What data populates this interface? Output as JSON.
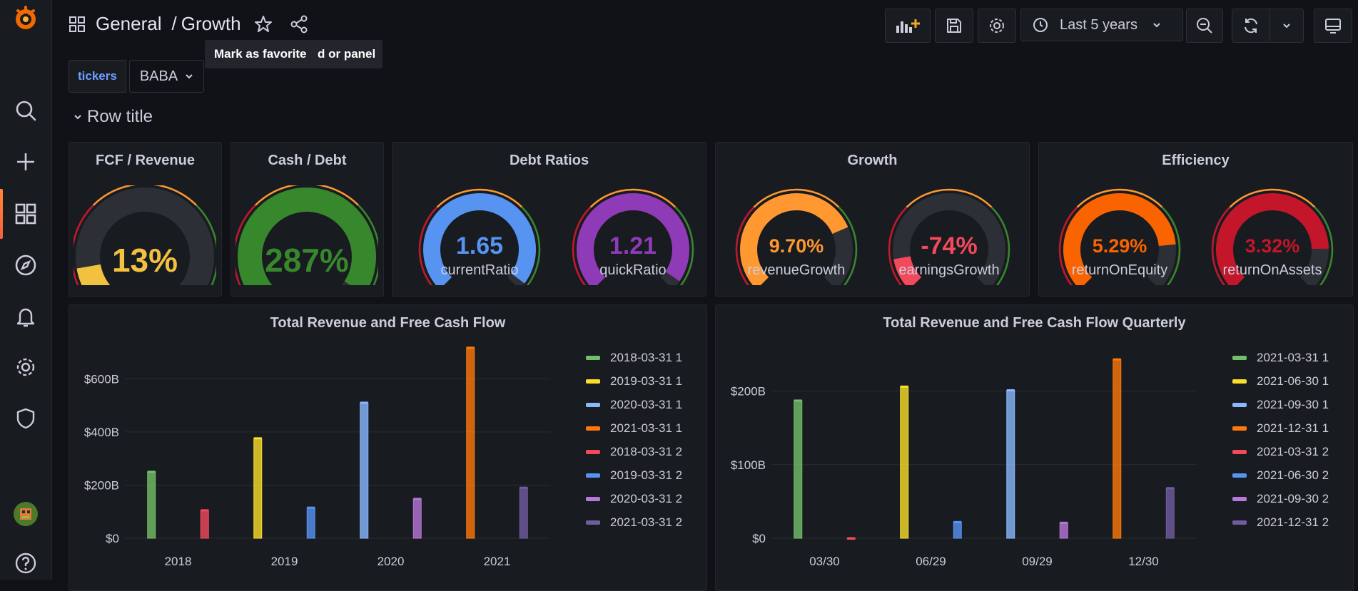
{
  "header": {
    "folder": "General",
    "separator": "/",
    "dashboard": "Growth",
    "time_range": "Last 5 years",
    "tooltip_left": "Mark as favorite",
    "tooltip_right": "d or panel"
  },
  "variables": {
    "label": "tickers",
    "value": "BABA"
  },
  "row": {
    "title": "Row title"
  },
  "panels": {
    "fcf": {
      "title": "FCF / Revenue"
    },
    "cash": {
      "title": "Cash / Debt"
    },
    "debt": {
      "title": "Debt Ratios"
    },
    "growth": {
      "title": "Growth"
    },
    "efficiency": {
      "title": "Efficiency"
    }
  },
  "gauges": [
    {
      "key": "fcf",
      "value_text": "13%",
      "value": 13,
      "min": 0,
      "max": 100,
      "label": "",
      "color": "#f2c140"
    },
    {
      "key": "cash",
      "value_text": "287%",
      "value": 287,
      "min": 0,
      "max": 300,
      "label": "",
      "color": "#37872d"
    },
    {
      "key": "current",
      "value_text": "1.65",
      "value": 1.65,
      "min": 0,
      "max": 1.7,
      "label": "currentRatio",
      "color": "#5794f2"
    },
    {
      "key": "quick",
      "value_text": "1.21",
      "value": 1.21,
      "min": 0,
      "max": 1.26,
      "label": "quickRatio",
      "color": "#8f3bb8"
    },
    {
      "key": "revenueGrowth",
      "value_text": "9.70%",
      "value": 9.7,
      "min": 0,
      "max": 13,
      "label": "revenueGrowth",
      "color": "#ff9830"
    },
    {
      "key": "earningsGrowth",
      "value_text": "-74%",
      "value": -74,
      "min": -100,
      "max": 100,
      "label": "earningsGrowth",
      "color": "#f2495c"
    },
    {
      "key": "roe",
      "value_text": "5.29%",
      "value": 5.29,
      "min": 0,
      "max": 6.5,
      "label": "returnOnEquity",
      "color": "#fa6400"
    },
    {
      "key": "roa",
      "value_text": "3.32%",
      "value": 3.32,
      "min": 0,
      "max": 4,
      "label": "returnOnAssets",
      "color": "#c4162a"
    }
  ],
  "chart_data": [
    {
      "type": "bar",
      "title": "Total Revenue and Free Cash Flow",
      "categories": [
        "2018",
        "2019",
        "2020",
        "2021"
      ],
      "y_ticks": [
        "$0",
        "$200B",
        "$400B",
        "$600B"
      ],
      "ylim": [
        0,
        770
      ],
      "series": [
        {
          "name": "2018-03-31 1",
          "color": "#73bf69",
          "values": [
            250,
            null,
            null,
            null
          ]
        },
        {
          "name": "2019-03-31 1",
          "color": "#fade2a",
          "values": [
            null,
            376,
            null,
            null
          ]
        },
        {
          "name": "2020-03-31 1",
          "color": "#8ab8ff",
          "values": [
            null,
            null,
            510,
            null
          ]
        },
        {
          "name": "2021-03-31 1",
          "color": "#ff780a",
          "values": [
            null,
            null,
            null,
            717
          ]
        },
        {
          "name": "2018-03-31 2",
          "color": "#f2495c",
          "values": [
            105,
            null,
            null,
            null
          ]
        },
        {
          "name": "2019-03-31 2",
          "color": "#5794f2",
          "values": [
            null,
            115,
            null,
            null
          ]
        },
        {
          "name": "2020-03-31 2",
          "color": "#b877d9",
          "values": [
            null,
            null,
            148,
            null
          ]
        },
        {
          "name": "2021-03-31 2",
          "color": "#705da0",
          "values": [
            null,
            null,
            null,
            190
          ]
        }
      ]
    },
    {
      "type": "bar",
      "title": "Total Revenue and Free Cash Flow Quarterly",
      "categories": [
        "03/30",
        "06/29",
        "09/29",
        "12/30"
      ],
      "y_ticks": [
        "$0",
        "$100B",
        "$200B"
      ],
      "ylim": [
        0,
        278
      ],
      "series": [
        {
          "name": "2021-03-31 1",
          "color": "#73bf69",
          "values": [
            187,
            null,
            null,
            null
          ]
        },
        {
          "name": "2021-06-30 1",
          "color": "#fade2a",
          "values": [
            null,
            206,
            null,
            null
          ]
        },
        {
          "name": "2021-09-30 1",
          "color": "#8ab8ff",
          "values": [
            null,
            null,
            201,
            null
          ]
        },
        {
          "name": "2021-12-31 1",
          "color": "#ff780a",
          "values": [
            null,
            null,
            null,
            243
          ]
        },
        {
          "name": "2021-03-31 2",
          "color": "#f2495c",
          "values": [
            -1,
            null,
            null,
            null
          ]
        },
        {
          "name": "2021-06-30 2",
          "color": "#5794f2",
          "values": [
            null,
            22,
            null,
            null
          ]
        },
        {
          "name": "2021-09-30 2",
          "color": "#b877d9",
          "values": [
            null,
            null,
            21,
            null
          ]
        },
        {
          "name": "2021-12-31 2",
          "color": "#705da0",
          "values": [
            null,
            null,
            null,
            68
          ]
        }
      ]
    }
  ]
}
